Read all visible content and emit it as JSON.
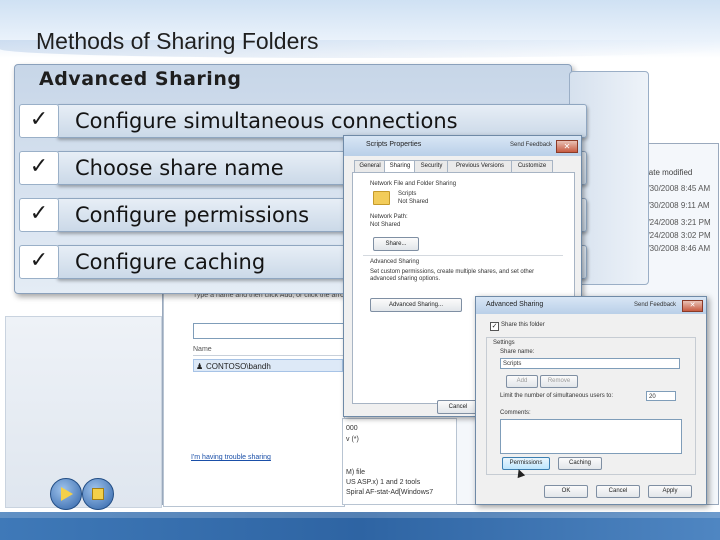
{
  "slide": {
    "title": "Methods of Sharing Folders"
  },
  "panel": {
    "title": "Advanced Sharing",
    "items": [
      {
        "check": "✓",
        "label": "Configure simultaneous connections"
      },
      {
        "check": "✓",
        "label": "Choose share name"
      },
      {
        "check": "✓",
        "label": "Configure permissions"
      },
      {
        "check": "✓",
        "label": "Configure caching"
      }
    ]
  },
  "explorer": {
    "date_modified_header": "Date modified",
    "dates": [
      "1/30/2008 8:45 AM",
      "1/30/2008 9:11 AM",
      "2/24/2008 3:21 PM",
      "2/24/2008 3:02 PM",
      "1/30/2008 8:46 AM"
    ],
    "instruction_text": "Type a name and then click Add, or click the arrow to find someone.",
    "name_header": "Name",
    "selected_user": "CONTOSO\\bandh",
    "user_icon": "user-icon",
    "learn_link": "I'm having trouble sharing",
    "side_panel_lines": [
      "000",
      "v (*)",
      "",
      "M) file",
      "US ASP.x) 1 and 2 tools",
      "Spiral AF-stat-Ad[Windows7"
    ]
  },
  "scripts_properties": {
    "title": "Scripts Properties",
    "send_feedback": "Send Feedback",
    "close": "✕",
    "tabs": [
      "General",
      "Sharing",
      "Security",
      "Previous Versions",
      "Customize"
    ],
    "selected_tab": "Sharing",
    "network_section": "Network File and Folder Sharing",
    "folder_name": "Scripts",
    "folder_status": "Not Shared",
    "network_path_label": "Network Path:",
    "network_path_value": "Not Shared",
    "share_button": "Share...",
    "advanced_section": "Advanced Sharing",
    "advanced_desc": "Set custom permissions, create multiple shares, and set other advanced sharing options.",
    "advanced_button": "Advanced Sharing...",
    "cancel_button": "Cancel"
  },
  "advanced_dialog": {
    "title": "Advanced Sharing",
    "send_feedback": "Send Feedback",
    "close": "✕",
    "share_checkbox_label": "Share this folder",
    "share_checked": true,
    "settings_label": "Settings",
    "share_name_label": "Share name:",
    "share_name_value": "Scripts",
    "add_button": "Add",
    "remove_button": "Remove",
    "limit_label": "Limit the number of simultaneous users to:",
    "limit_value": "20",
    "comments_label": "Comments:",
    "permissions_button": "Permissions",
    "caching_button": "Caching",
    "ok_button": "OK",
    "cancel_button": "Cancel",
    "apply_button": "Apply"
  },
  "nav": {
    "prev_icon": "play-icon",
    "next_icon": "stop-icon"
  },
  "colors": {
    "accent_blue": "#2e64a3",
    "panel_bg": "#c7d6e8",
    "check_color": "#1a1a1a"
  }
}
